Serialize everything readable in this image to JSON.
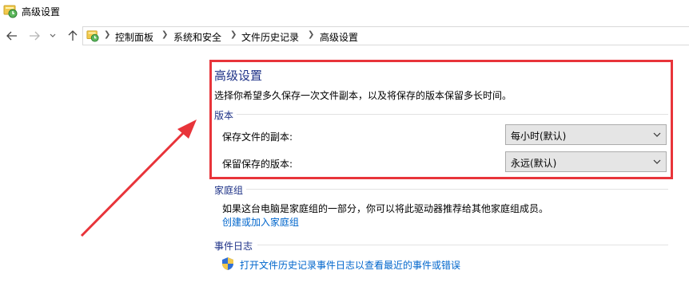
{
  "window": {
    "title": "高级设置"
  },
  "nav": {
    "breadcrumbs": [
      "控制面板",
      "系统和安全",
      "文件历史记录",
      "高级设置"
    ]
  },
  "main": {
    "title": "高级设置",
    "description": "选择你希望多久保存一次文件副本，以及将保存的版本保留多长时间。",
    "versions": {
      "header": "版本",
      "save_copies_label": "保存文件的副本:",
      "save_copies_value": "每小时(默认)",
      "keep_versions_label": "保留保存的版本:",
      "keep_versions_value": "永远(默认)"
    },
    "homegroup": {
      "header": "家庭组",
      "text": "如果这台电脑是家庭组的一部分，你可以将此驱动器推荐给其他家庭组成员。",
      "link": "创建或加入家庭组"
    },
    "event_log": {
      "header": "事件日志",
      "link": "打开文件历史记录事件日志以查看最近的事件或错误"
    }
  },
  "colors": {
    "heading": "#1e3287",
    "link": "#0066cc",
    "annotation": "#e8343a"
  }
}
